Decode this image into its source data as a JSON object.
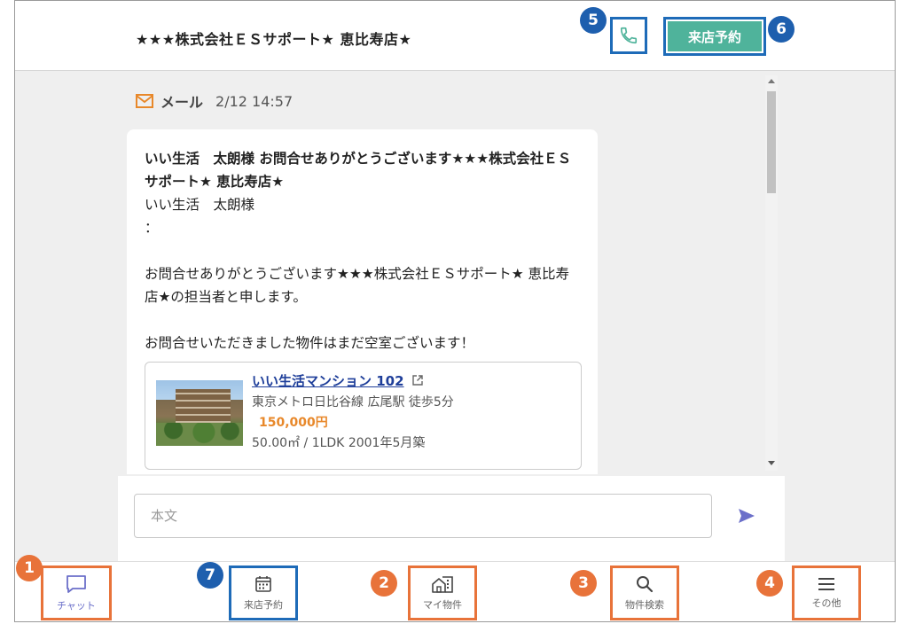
{
  "header": {
    "shop_title": "★★★株式会社ＥＳサポート★ 恵比寿店★",
    "reserve_label": "来店予約",
    "phone_icon": "phone-icon"
  },
  "badges": {
    "b1": "1",
    "b2": "2",
    "b3": "3",
    "b4": "4",
    "b5": "5",
    "b6": "6",
    "b7": "7"
  },
  "message": {
    "channel_icon": "mail-icon",
    "channel_label": "メール",
    "timestamp": "2/12 14:57",
    "subject": "いい生活　太朗様 お問合せありがとうございます★★★株式会社ＥＳサポート★ 恵比寿店★",
    "greeting": "いい生活　太朗様",
    "colon": "：",
    "body1": "お問合せありがとうございます★★★株式会社ＥＳサポート★ 恵比寿店★の担当者と申します。",
    "body2": "お問合せいただきました物件はまだ空室ございます！"
  },
  "property": {
    "name": "いい生活マンション 102",
    "external_icon": "external-link-icon",
    "access": "東京メトロ日比谷線 広尾駅 徒歩5分",
    "price": "150,000円",
    "details": "50.00㎡ / 1LDK  2001年5月築"
  },
  "composer": {
    "placeholder": "本文",
    "send_icon": "send-icon"
  },
  "nav": {
    "chat": "チャット",
    "reserve": "来店予約",
    "my_property": "マイ物件",
    "search": "物件検索",
    "other": "その他"
  },
  "colors": {
    "accent_green": "#4fb39b",
    "highlight_blue": "#1e6bb8",
    "highlight_orange": "#e8733a",
    "price_orange": "#e8882a",
    "link_blue": "#1f3f9a"
  }
}
